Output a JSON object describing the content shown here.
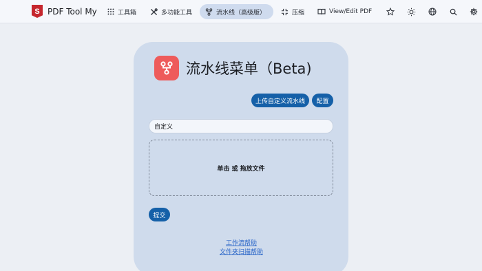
{
  "nav": {
    "brand": "PDF Tool My",
    "brand_logo": "S",
    "items": [
      {
        "label": "工具箱",
        "icon": "grid-icon"
      },
      {
        "label": "多功能工具",
        "icon": "tools-icon"
      },
      {
        "label": "流水线（高级版）",
        "icon": "pipeline-icon",
        "active": true
      },
      {
        "label": "压缩",
        "icon": "compress-icon"
      },
      {
        "label": "View/Edit PDF",
        "icon": "book-icon"
      }
    ],
    "actions": [
      "star-icon",
      "theme-icon",
      "language-icon",
      "search-icon",
      "settings-icon"
    ]
  },
  "card": {
    "title": "流水线菜单（Beta)",
    "upload_button": "上传自定义流水线",
    "config_button": "配置",
    "name_value": "自定义",
    "dropzone_text": "单击 或 拖放文件",
    "submit_button": "提交",
    "links": [
      "工作流帮助",
      "文件夹扫描帮助"
    ]
  },
  "colors": {
    "accent": "#1560a8",
    "card_bg": "#cfdbec",
    "app_icon": "#ee5b5b",
    "brand_logo": "#c5262d"
  }
}
